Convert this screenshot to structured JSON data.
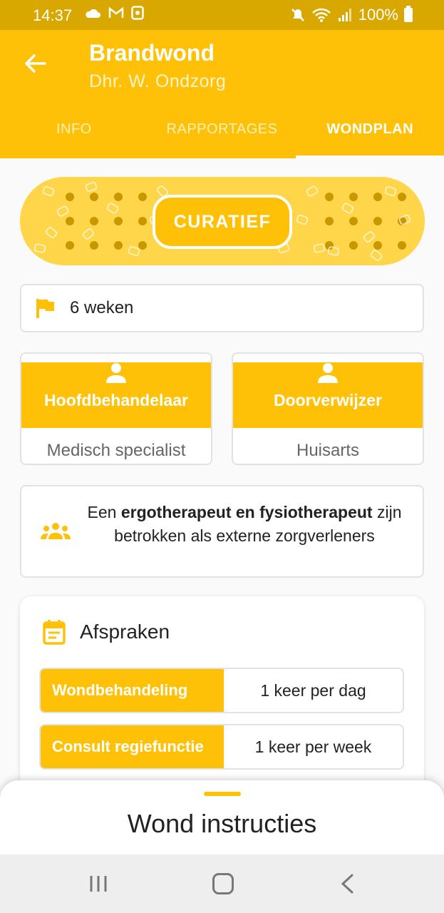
{
  "status_bar": {
    "time": "14:37",
    "battery": "100%",
    "icons": [
      "cloud-icon",
      "gmail-icon",
      "app-notification-icon",
      "mute-icon",
      "wifi-icon",
      "signal-icon",
      "battery-icon"
    ]
  },
  "header": {
    "title": "Brandwond",
    "subtitle": "Dhr. W. Ondzorg"
  },
  "tabs": [
    {
      "label": "INFO",
      "active": false
    },
    {
      "label": "RAPPORTAGES",
      "active": false
    },
    {
      "label": "WONDPLAN",
      "active": true
    }
  ],
  "plan_type": "CURATIEF",
  "duration": "6 weken",
  "roles": [
    {
      "title": "Hoofdbehandelaar",
      "value": "Medisch specialist"
    },
    {
      "title": "Doorverwijzer",
      "value": "Huisarts"
    }
  ],
  "external": {
    "prefix": "Een ",
    "bold": "ergotherapeut en fysiotherapeut",
    "suffix": " zijn betrokken als externe zorgverleners"
  },
  "afspraken": {
    "title": "Afspraken",
    "rows": [
      {
        "label": "Wondbehandeling",
        "value": "1 keer per dag"
      },
      {
        "label": "Consult regiefunctie",
        "value": "1 keer per week"
      }
    ]
  },
  "sheet": {
    "title": "Wond instructies"
  },
  "colors": {
    "primary": "#ffc107",
    "status_bar": "#d8a800",
    "plaster": "#ffd54a"
  }
}
